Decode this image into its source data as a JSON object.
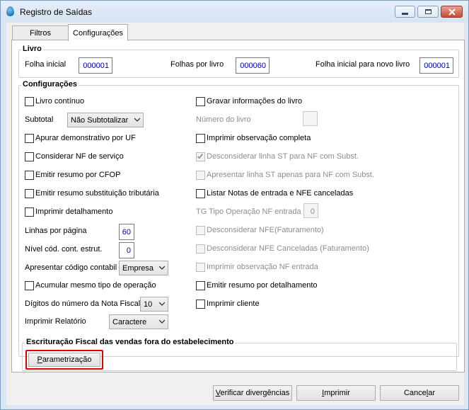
{
  "window": {
    "title": "Registro de Saídas",
    "controls": {
      "minimize_icon": "minimize-icon",
      "maximize_icon": "maximize-icon",
      "close_icon": "close-icon"
    }
  },
  "tabs": [
    {
      "label": "Filtros",
      "active": false
    },
    {
      "label": "Configurações",
      "active": true
    }
  ],
  "livro": {
    "title": "Livro",
    "folha_inicial": {
      "label": "Folha inicial",
      "value": "000001"
    },
    "folhas_por_livro": {
      "label": "Folhas por livro",
      "value": "000060"
    },
    "folha_novo_livro": {
      "label": "Folha inicial para novo livro",
      "value": "000001"
    }
  },
  "config": {
    "title": "Configurações",
    "left": {
      "livro_continuo": {
        "label": "Livro contínuo",
        "checked": false
      },
      "subtotal": {
        "label": "Subtotal",
        "value": "Não Subtotalizar"
      },
      "apurar_uf": {
        "label": "Apurar demonstrativo por UF",
        "checked": false
      },
      "nf_servico": {
        "label": "Considerar NF de serviço",
        "checked": false
      },
      "resumo_cfop": {
        "label": "Emitir resumo por CFOP",
        "checked": false
      },
      "resumo_st": {
        "label": "Emitir resumo substituição tributária",
        "checked": false
      },
      "detalhamento": {
        "label": "Imprimir detalhamento",
        "checked": false
      },
      "linhas_pagina": {
        "label": "Linhas por página",
        "value": "60"
      },
      "nivel_cod": {
        "label": "Nível cód. cont. estrut.",
        "value": "0"
      },
      "cod_contabil": {
        "label": "Apresentar código contabil",
        "value": "Empresa"
      },
      "acumular": {
        "label": "Acumular mesmo tipo de operação",
        "checked": false
      },
      "digitos_nf": {
        "label": "Dígitos do número da Nota Fiscal",
        "value": "10"
      },
      "imprimir_relatorio": {
        "label": "Imprimir Relatório",
        "value": "Caractere"
      }
    },
    "right": {
      "gravar_info": {
        "label": "Gravar informações do livro",
        "checked": false
      },
      "numero_livro": {
        "label": "Número do livro",
        "value": ""
      },
      "obs_completa": {
        "label": "Imprimir observação completa",
        "checked": false
      },
      "desconsiderar_st": {
        "label": "Desconsiderar linha ST para NF com Subst.",
        "checked": true,
        "disabled": true
      },
      "apresentar_st": {
        "label": "Apresentar linha ST apenas para NF com Subst.",
        "checked": false,
        "disabled": true
      },
      "listar_canceladas": {
        "label": "Listar Notas de entrada e NFE canceladas",
        "checked": false
      },
      "tg_tipo": {
        "label": "TG Tipo Operação NF entrada",
        "value": "0"
      },
      "desc_nfe_fat": {
        "label": "Desconsiderar NFE(Faturamento)",
        "checked": false,
        "disabled": true
      },
      "desc_nfe_canc": {
        "label": "Desconsiderar NFE Canceladas (Faturamento)",
        "checked": false,
        "disabled": true
      },
      "obs_nf_entrada": {
        "label": "Imprimir observação NF entrada",
        "checked": false,
        "disabled": true
      },
      "resumo_detalhamento": {
        "label": "Emitir resumo por detalhamento",
        "checked": false
      },
      "imprimir_cliente": {
        "label": "Imprimir cliente",
        "checked": false
      }
    }
  },
  "escrituracao": {
    "title": "Escrituração Fiscal das vendas fora do estabelecimento",
    "button": {
      "label": "Parametrização",
      "hotkey": "P",
      "rest": "arametrização"
    }
  },
  "footer": {
    "verificar": {
      "label": "Verificar divergências",
      "hotkey": "V",
      "rest": "erificar divergências"
    },
    "imprimir": {
      "label": "Imprimir",
      "hotkey": "I",
      "rest": "mprimir"
    },
    "cancelar": {
      "label": "Cancelar",
      "pre": "Cance",
      "hotkey": "l",
      "rest": "ar"
    }
  },
  "colors": {
    "highlight": "#e00000",
    "value_text": "#0000aa",
    "disabled_text": "#8d8d8d"
  }
}
